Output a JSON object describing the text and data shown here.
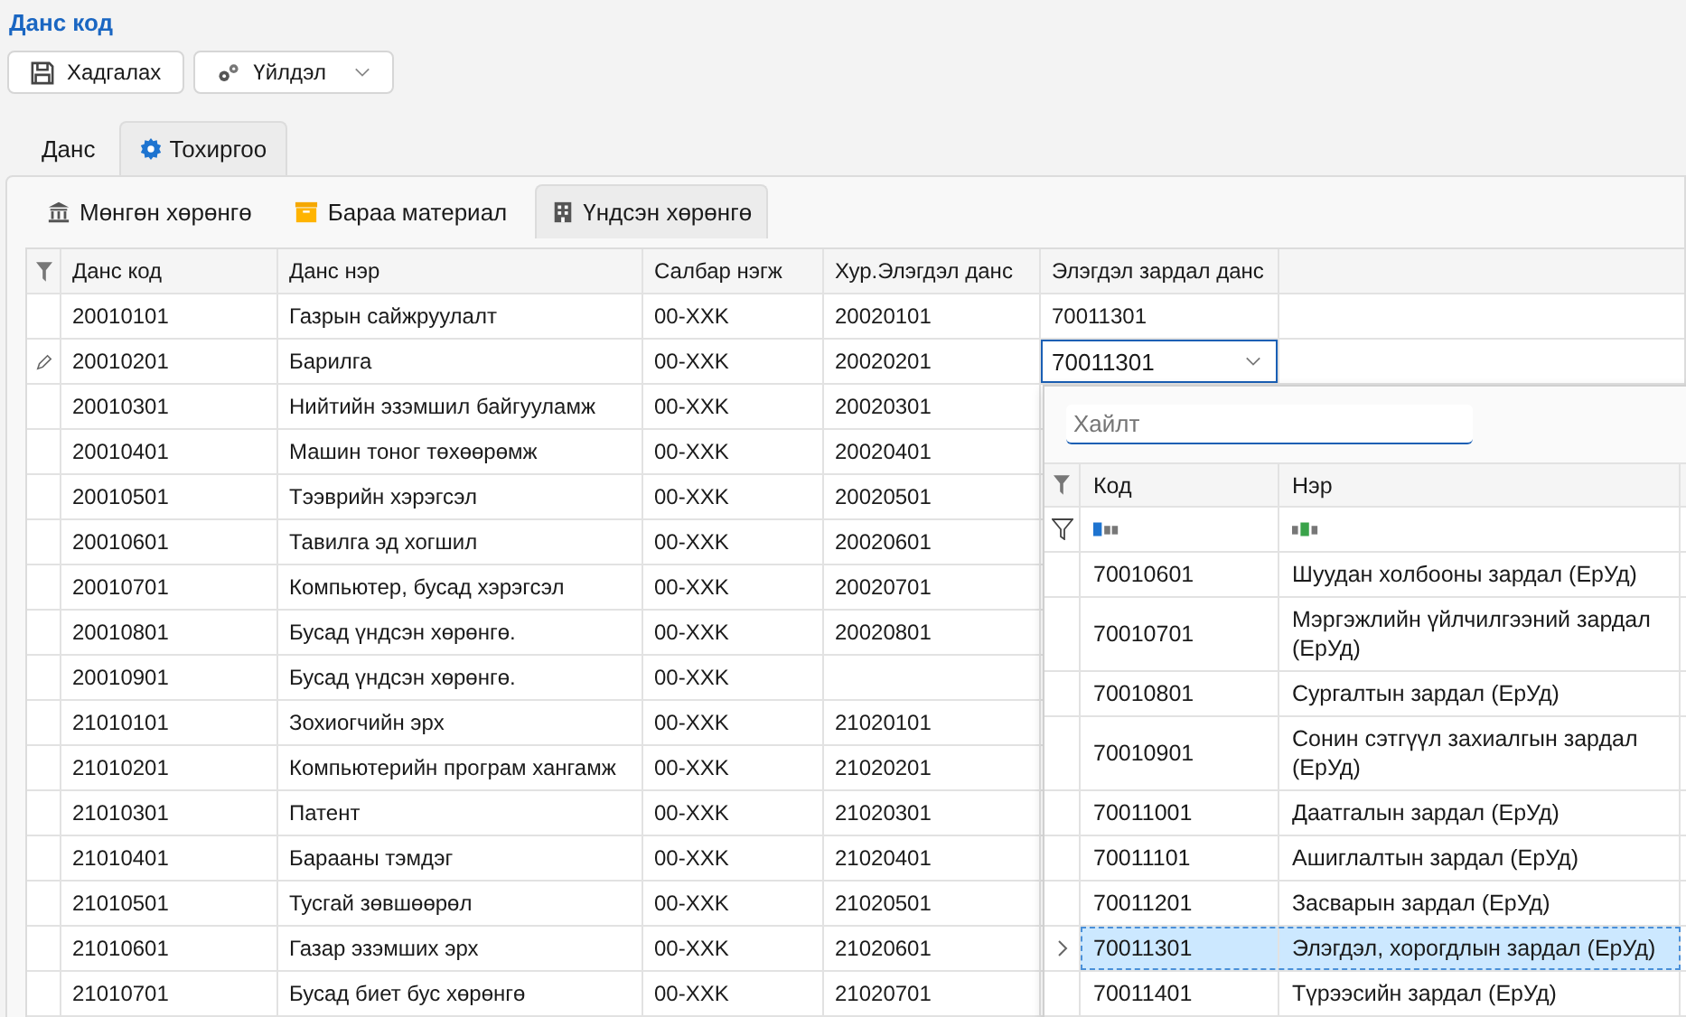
{
  "title": "Данс код",
  "toolbar": [
    {
      "label": "Хадгалах",
      "kind": "save"
    },
    {
      "label": "Үйлдэл",
      "kind": "actions"
    }
  ],
  "tabs": [
    {
      "label": "Данс",
      "selected": false
    },
    {
      "label": "Тохиргоо",
      "selected": true
    }
  ],
  "sub_tabs": [
    {
      "label": "Мөнгөн хөрөнгө",
      "selected": false
    },
    {
      "label": "Бараа материал",
      "selected": false
    },
    {
      "label": "Үндсэн хөрөнгө",
      "selected": true
    }
  ],
  "grid": {
    "columns": [
      "Данс код",
      "Данс нэр",
      "Салбар нэгж",
      "Хур.Элэгдэл данс",
      "Элэгдэл зардал данс"
    ],
    "rows": [
      {
        "code": "20010101",
        "name": "Газрын сайжруулалт",
        "unit": "00-XXK",
        "accumulated_account": "20020101",
        "expense_account": "70011301",
        "editing": false
      },
      {
        "code": "20010201",
        "name": "Барилга",
        "unit": "00-XXK",
        "accumulated_account": "20020201",
        "expense_account": "70011301",
        "editing": true
      },
      {
        "code": "20010301",
        "name": "Нийтийн эзэмшил байгууламж",
        "unit": "00-XXK",
        "accumulated_account": "20020301",
        "editing": false
      },
      {
        "code": "20010401",
        "name": "Машин тоног төхөөрөмж",
        "unit": "00-XXK",
        "accumulated_account": "20020401",
        "editing": false
      },
      {
        "code": "20010501",
        "name": "Тээврийн хэрэгсэл",
        "unit": "00-XXK",
        "accumulated_account": "20020501",
        "editing": false
      },
      {
        "code": "20010601",
        "name": "Тавилга эд хогшил",
        "unit": "00-XXK",
        "accumulated_account": "20020601",
        "editing": false
      },
      {
        "code": "20010701",
        "name": "Компьютер, бусад хэрэгсэл",
        "unit": "00-XXK",
        "accumulated_account": "20020701",
        "editing": false
      },
      {
        "code": "20010801",
        "name": "Бусад үндсэн хөрөнгө.",
        "unit": "00-XXK",
        "accumulated_account": "20020801",
        "editing": false
      },
      {
        "code": "20010901",
        "name": "Бусад үндсэн хөрөнгө.",
        "unit": "00-XXK",
        "editing": false
      },
      {
        "code": "21010101",
        "name": "Зохиогчийн эрх",
        "unit": "00-XXK",
        "accumulated_account": "21020101",
        "editing": false
      },
      {
        "code": "21010201",
        "name": "Компьютерийн програм хангамж",
        "unit": "00-XXK",
        "accumulated_account": "21020201",
        "editing": false
      },
      {
        "code": "21010301",
        "name": "Патент",
        "unit": "00-XXK",
        "accumulated_account": "21020301",
        "editing": false
      },
      {
        "code": "21010401",
        "name": "Барааны тэмдэг",
        "unit": "00-XXK",
        "accumulated_account": "21020401",
        "editing": false
      },
      {
        "code": "21010501",
        "name": "Тусгай зөвшөөрөл",
        "unit": "00-XXK",
        "accumulated_account": "21020501",
        "editing": false
      },
      {
        "code": "21010601",
        "name": "Газар эзэмших эрх",
        "unit": "00-XXK",
        "accumulated_account": "21020601",
        "editing": false
      },
      {
        "code": "21010701",
        "name": "Бусад биет бус хөрөнгө",
        "unit": "00-XXK",
        "accumulated_account": "21020701",
        "editing": false
      }
    ]
  },
  "lookup": {
    "search": {
      "placeholder": "Хайлт"
    },
    "columns": [
      "Код",
      "Нэр"
    ],
    "rows": [
      {
        "code": "70010601",
        "name": "Шуудан холбооны зардал (ЕрУд)",
        "selected": false
      },
      {
        "code": "70010701",
        "name": "Мэргэжлийн үйлчилгээний зардал (ЕрУд)",
        "selected": false
      },
      {
        "code": "70010801",
        "name": "Сургалтын зардал (ЕрУд)",
        "selected": false
      },
      {
        "code": "70010901",
        "name": "Сонин сэтгүүл захиалгын зардал (ЕрУд)",
        "selected": false
      },
      {
        "code": "70011001",
        "name": "Даатгалын зардал (ЕрУд)",
        "selected": false
      },
      {
        "code": "70011101",
        "name": "Ашиглалтын зардал (ЕрУд)",
        "selected": false
      },
      {
        "code": "70011201",
        "name": "Засварын зардал (ЕрУд)",
        "selected": false
      },
      {
        "code": "70011301",
        "name": "Элэгдэл, хорогдлын зардал (ЕрУд)",
        "selected": true
      },
      {
        "code": "70011401",
        "name": "Түрээсийн зардал (ЕрУд)",
        "selected": false
      }
    ]
  }
}
